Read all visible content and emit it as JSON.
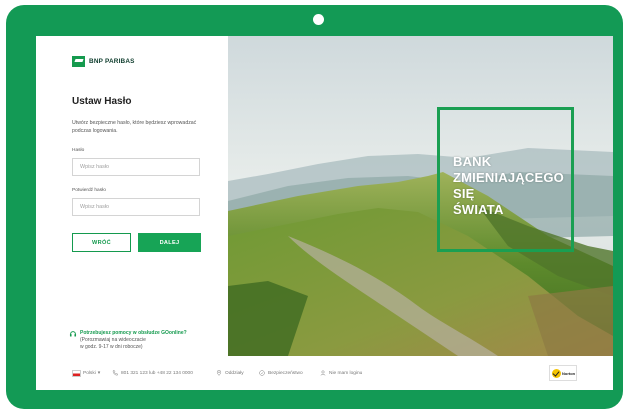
{
  "brand": {
    "name": "BNP PARIBAS",
    "color": "#139a55"
  },
  "form": {
    "title": "Ustaw Hasło",
    "description": "Utwórz bezpieczne hasło, które będziesz wprowadzać podczas logowania.",
    "password_label": "Hasło",
    "password_placeholder": "Wpisz hasło",
    "confirm_label": "Potwierdź hasło",
    "confirm_placeholder": "Wpisz hasło",
    "back_label": "WRÓĆ",
    "next_label": "DALEJ"
  },
  "help": {
    "link": "Potrzebujesz pomocy w obsłudze GOonline?",
    "line1": "(Porozmawiaj na wideoczacie",
    "line2": "w godz. 9-17 w dni robocze)",
    "icon": "headset-icon"
  },
  "hero": {
    "slogan": [
      "BANK",
      "ZMIENIAJĄCEGO",
      "SIĘ",
      "ŚWIATA"
    ],
    "accent": "#1a9f52"
  },
  "footer": {
    "language": "Polski",
    "phone": "801 321 123 lub +48 22 134 0000",
    "branches": "Oddziały",
    "security": "Bezpieczeństwo",
    "no_login": "Nie mam loginu",
    "badge": "Norton"
  }
}
